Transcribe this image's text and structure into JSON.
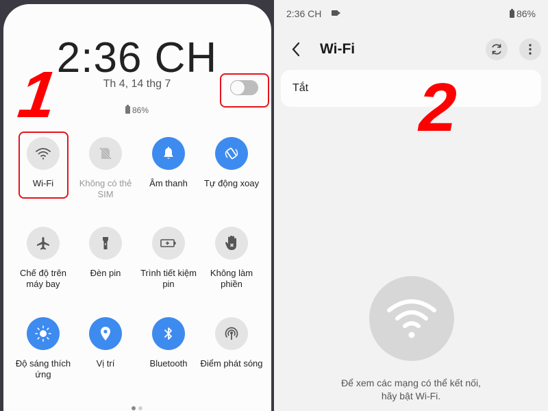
{
  "left_panel": {
    "clock": "2:36 CH",
    "date": "Th 4, 14 thg 7",
    "battery": "86%",
    "step_label": "1",
    "tiles": [
      {
        "label": "Wi-Fi",
        "icon": "wifi-icon",
        "state": "off"
      },
      {
        "label": "Không có thẻ SIM",
        "icon": "no-sim-icon",
        "state": "disabled"
      },
      {
        "label": "Âm thanh",
        "icon": "bell-icon",
        "state": "on"
      },
      {
        "label": "Tự động xoay",
        "icon": "auto-rotate-icon",
        "state": "on"
      },
      {
        "label": "Chế độ trên máy bay",
        "icon": "airplane-icon",
        "state": "off"
      },
      {
        "label": "Đèn pin",
        "icon": "flashlight-icon",
        "state": "off"
      },
      {
        "label": "Trình tiết kiệm pin",
        "icon": "battery-saver-icon",
        "state": "off"
      },
      {
        "label": "Không làm phiền",
        "icon": "do-not-disturb-icon",
        "state": "off"
      },
      {
        "label": "Độ sáng thích ứng",
        "icon": "brightness-icon",
        "state": "on"
      },
      {
        "label": "Vị trí",
        "icon": "location-icon",
        "state": "on"
      },
      {
        "label": "Bluetooth",
        "icon": "bluetooth-icon",
        "state": "on"
      },
      {
        "label": "Điểm phát sóng",
        "icon": "hotspot-icon",
        "state": "off"
      }
    ],
    "page_indicator": {
      "current": 1,
      "total": 2
    }
  },
  "right_panel": {
    "status_time": "2:36 CH",
    "status_battery": "86%",
    "title": "Wi-Fi",
    "toggle_label": "Tắt",
    "toggle_on": false,
    "step_label": "2",
    "hint_line1": "Để xem các mạng có thể kết nối,",
    "hint_line2": "hãy bật Wi-Fi."
  },
  "colors": {
    "accent_on": "#3e8bef",
    "tile_off": "#e4e4e4",
    "highlight": "#e5131b",
    "step_number": "#ff0000"
  }
}
